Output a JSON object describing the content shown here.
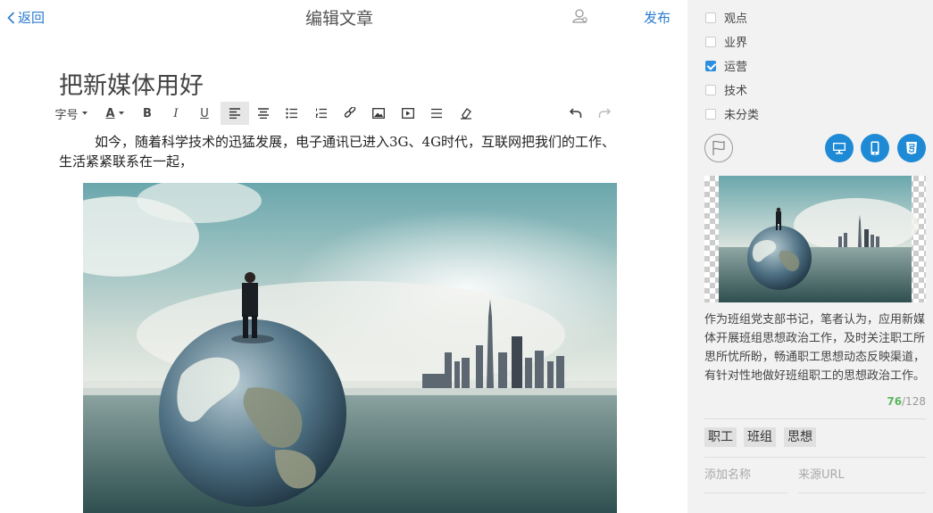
{
  "header": {
    "back_label": "返回",
    "title": "编辑文章",
    "publish_label": "发布"
  },
  "article": {
    "title": "把新媒体用好",
    "paragraph": "如今，随着科学技术的迅猛发展，电子通讯已进入3G、4G时代，互联网把我们的工作、生活紧紧联系在一起，"
  },
  "toolbar": {
    "font_size_label": "字号",
    "font_color_label": "A",
    "bold_label": "B",
    "italic_label": "I",
    "underline_label": "U"
  },
  "sidebar": {
    "categories": [
      {
        "label": "观点",
        "checked": false
      },
      {
        "label": "业界",
        "checked": false
      },
      {
        "label": "运营",
        "checked": true
      },
      {
        "label": "技术",
        "checked": false
      },
      {
        "label": "未分类",
        "checked": false
      }
    ],
    "summary": "作为班组党支部书记，笔者认为，应用新媒体开展班组思想政治工作，及时关注职工所思所忧所盼，畅通职工思想动态反映渠道，有针对性地做好班组职工的思想政治工作。",
    "char_count": "76",
    "char_limit": "/128",
    "tags": [
      "职工",
      "班组",
      "思想"
    ],
    "author_placeholder": "添加名称",
    "source_placeholder": "来源URL"
  },
  "colors": {
    "accent": "#2a7bd0",
    "count_ok": "#5bb85d",
    "sidebar_bg": "#f2f2f2"
  }
}
